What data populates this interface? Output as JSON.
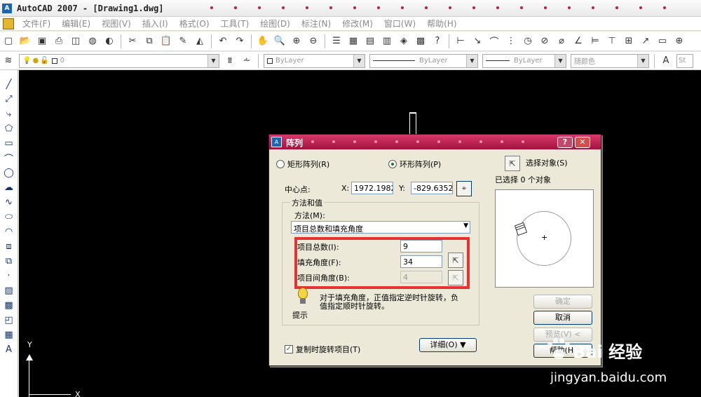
{
  "window": {
    "title": "AutoCAD 2007 - [Drawing1.dwg]",
    "app_icon": "autocad-logo-icon"
  },
  "menu": {
    "items": [
      "文件(F)",
      "编辑(E)",
      "视图(V)",
      "插入(I)",
      "格式(O)",
      "工具(T)",
      "绘图(D)",
      "标注(N)",
      "修改(M)",
      "窗口(W)",
      "帮助(H)"
    ]
  },
  "layers_toolbar": {
    "layer_value": "0",
    "color_value": "ByLayer",
    "linetype_value": "ByLayer",
    "lineweight_value": "ByLayer",
    "plotstyle_value": "随颜色",
    "style_value": "St"
  },
  "canvas": {
    "ucs_y": "Y",
    "ucs_x": "X"
  },
  "dialog": {
    "title": "阵列",
    "help_label": "?",
    "close_label": "✕",
    "rect_array_label": "矩形阵列(R)",
    "polar_array_label": "环形阵列(P)",
    "selected_mode": "polar",
    "select_objects_label": "选择对象(S)",
    "selected_count_label": "已选择 0 个对象",
    "center_label": "中心点:",
    "x_label": "X:",
    "x_value": "1972.1982",
    "y_label": "Y:",
    "y_value": "-829.6352",
    "method_group_title": "方法和值",
    "method_label": "方法(M):",
    "method_value": "项目总数和填充角度",
    "total_items_label": "项目总数(I):",
    "total_items_value": "9",
    "fill_angle_label": "填充角度(F):",
    "fill_angle_value": "34",
    "angle_between_label": "项目间角度(B):",
    "angle_between_value": "4",
    "tip_text_line1": "对于填充角度，正值指定逆时针旋转，负",
    "tip_text_line2": "值指定顺时针旋转。",
    "tip_label": "提示",
    "rotate_label": "复制时旋转项目(T)",
    "rotate_checked": true,
    "details_label": "详细(O) ▼",
    "ok_label": "确定",
    "cancel_label": "取消",
    "preview_label": "预览(V) <",
    "help_btn_label": "帮助(H)"
  },
  "watermark": {
    "brand": "Bai 经验",
    "url": "jingyan.baidu.com"
  }
}
